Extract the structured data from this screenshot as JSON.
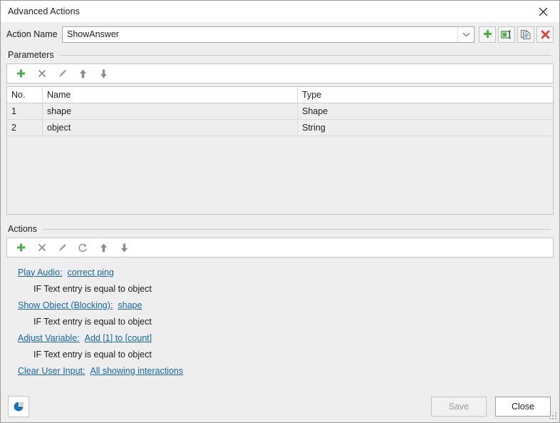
{
  "window": {
    "title": "Advanced Actions",
    "close_icon": "close-icon"
  },
  "action_name": {
    "label": "Action Name",
    "value": "ShowAnswer",
    "dropdown_icon": "chevron-down-icon",
    "buttons": [
      {
        "name": "add-action-button",
        "icon": "plus-icon",
        "tooltip": "Add"
      },
      {
        "name": "rename-action-button",
        "icon": "rename-icon",
        "tooltip": "Rename"
      },
      {
        "name": "duplicate-action-button",
        "icon": "copy-icon",
        "tooltip": "Duplicate"
      },
      {
        "name": "delete-action-button",
        "icon": "delete-x-icon",
        "tooltip": "Delete"
      }
    ]
  },
  "parameters": {
    "group_label": "Parameters",
    "toolbar": [
      {
        "name": "add-parameter-button",
        "icon": "plus-icon"
      },
      {
        "name": "delete-parameter-button",
        "icon": "x-icon"
      },
      {
        "name": "edit-parameter-button",
        "icon": "pencil-icon"
      },
      {
        "name": "move-parameter-up-button",
        "icon": "arrow-up-icon"
      },
      {
        "name": "move-parameter-down-button",
        "icon": "arrow-down-icon"
      }
    ],
    "columns": [
      "No.",
      "Name",
      "Type"
    ],
    "rows": [
      {
        "no": "1",
        "name": "shape",
        "type": "Shape"
      },
      {
        "no": "2",
        "name": "object",
        "type": "String"
      }
    ]
  },
  "actions": {
    "group_label": "Actions",
    "toolbar": [
      {
        "name": "add-action-step-button",
        "icon": "plus-icon"
      },
      {
        "name": "delete-action-step-button",
        "icon": "x-icon"
      },
      {
        "name": "edit-action-step-button",
        "icon": "pencil-icon"
      },
      {
        "name": "reset-action-step-button",
        "icon": "refresh-icon"
      },
      {
        "name": "move-action-step-up-button",
        "icon": "arrow-up-icon"
      },
      {
        "name": "move-action-step-down-button",
        "icon": "arrow-down-icon"
      }
    ],
    "items": [
      {
        "kind": "action",
        "label": "Play Audio:",
        "value": "correct ping"
      },
      {
        "kind": "condition",
        "text": "IF Text entry is equal to object"
      },
      {
        "kind": "action",
        "label": "Show Object (Blocking):",
        "value": "shape"
      },
      {
        "kind": "condition",
        "text": "IF Text entry is equal to object"
      },
      {
        "kind": "action",
        "label": "Adjust Variable:",
        "value": "Add [1] to [count]"
      },
      {
        "kind": "condition",
        "text": "IF Text entry is equal to object"
      },
      {
        "kind": "action",
        "label": "Clear User Input:",
        "value": "All showing interactions"
      }
    ]
  },
  "footer": {
    "report_icon": "pie-chart-icon",
    "save_label": "Save",
    "save_enabled": false,
    "close_label": "Close",
    "close_enabled": true
  },
  "colors": {
    "link": "#1564a8",
    "accent_green": "#4caf50",
    "accent_red": "#e03a34",
    "accent_blue": "#1a72b8",
    "window_bg": "#eeeeee"
  }
}
